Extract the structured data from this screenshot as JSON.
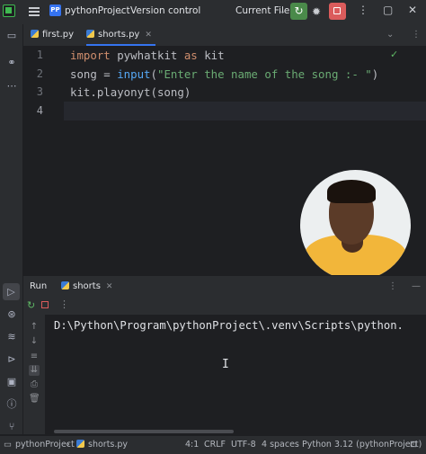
{
  "titlebar": {
    "project_badge": "PP",
    "project_name": "pythonProject",
    "vcs_label": "Version control",
    "run_config": "Current File"
  },
  "editor_tabs": [
    {
      "label": "first.py",
      "active": false
    },
    {
      "label": "shorts.py",
      "active": true
    }
  ],
  "editor": {
    "line_numbers": [
      "1",
      "2",
      "3",
      "4"
    ],
    "lines": [
      {
        "kw": "import",
        "rest": " pywhatkit ",
        "kw2": "as",
        "rest2": " kit"
      },
      {
        "pre": "song = ",
        "fn": "input",
        "open": "(",
        "str": "\"Enter the name of the song :- \"",
        "close": ")"
      },
      {
        "text": "kit.playonyt(song)"
      }
    ],
    "inspection_icon": "check-icon"
  },
  "run_panel": {
    "tab_run": "Run",
    "tab_config": "shorts",
    "console_line": "D:\\Python\\Program\\pythonProject\\.venv\\Scripts\\python.",
    "cursor_glyph": "I"
  },
  "statusbar": {
    "crumb_project": "pythonProject",
    "crumb_file": "shorts.py",
    "position": "4:1",
    "line_sep": "CRLF",
    "encoding": "UTF-8",
    "indent": "4 spaces",
    "interpreter": "Python 3.12 (pythonProject)"
  },
  "colors": {
    "accent": "#3574f0",
    "run_green": "#4a8a4a",
    "stop_red": "#db5c5c",
    "keyword": "#cf8e6d",
    "string": "#6aab73",
    "function": "#56a8f5"
  }
}
